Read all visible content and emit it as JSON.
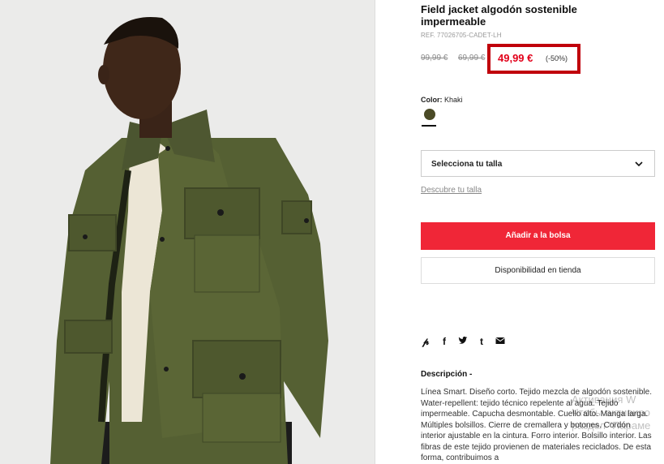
{
  "product": {
    "title": "Field jacket algodón sostenible impermeable",
    "ref": "REF. 77026705-CADET-LH",
    "prices": {
      "original": "99,99 €",
      "previous": "69,99 €",
      "current": "49,99 €",
      "discount": "(-50%)"
    },
    "color": {
      "label": "Color:",
      "value": "Khaki",
      "swatch_hex": "#4a4a26"
    },
    "size": {
      "select_label": "Selecciona tu talla",
      "help_link": "Descubre tu talla"
    },
    "actions": {
      "add_to_bag": "Añadir a la bolsa",
      "store_availability": "Disponibilidad en tienda"
    },
    "share_icons": [
      "pinterest-icon",
      "facebook-icon",
      "twitter-icon",
      "tumblr-icon",
      "email-icon"
    ],
    "description": {
      "title": "Descripción -",
      "text": "Línea Smart. Diseño corto. Tejido mezcla de algodón sostenible. Water-repellent: tejido técnico repelente al agua. Tejido impermeable. Capucha desmontable. Cuello alto. Manga larga. Múltiples bolsillos. Cierre de cremallera y botones. Cordón interior ajustable en la cintura. Forro interior. Bolsillo interior. Las fibras de este tejido provienen de materiales reciclados. De esta forma, contribuimos a"
    }
  },
  "os_watermark": {
    "line1": "Активация W",
    "line2": "Чтобы активиро",
    "line3": "раздел \"Параме"
  },
  "colors": {
    "accent": "#f02637",
    "price_red": "#e2001a",
    "highlight_box": "#c0000b"
  }
}
